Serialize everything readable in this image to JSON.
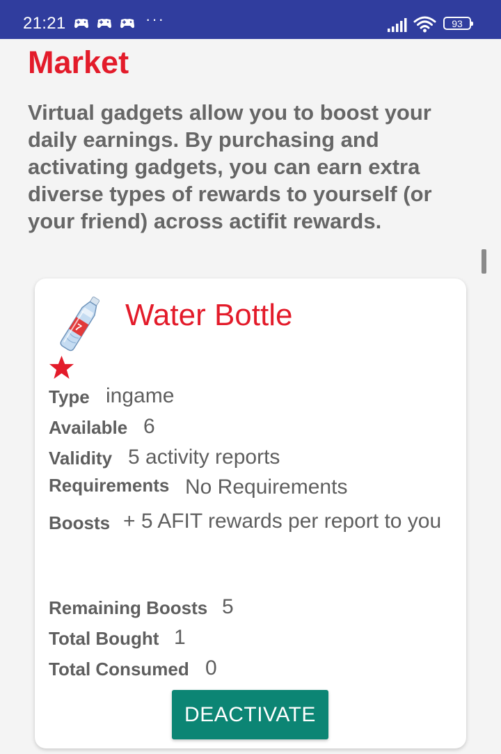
{
  "status_bar": {
    "time": "21:21",
    "notification_icons": [
      "game-controller-icon",
      "game-controller-icon",
      "game-controller-icon"
    ],
    "more": "···",
    "battery": "93",
    "background": "#303d9e"
  },
  "page": {
    "title": "Market",
    "intro": "Virtual gadgets allow you to boost your daily earnings. By purchasing and activating gadgets, you can earn extra diverse types of rewards to yourself (or your friend) across actifit rewards."
  },
  "gadget": {
    "name": "Water Bottle",
    "icon": "water-bottle-icon",
    "badge_icon": "star-icon",
    "fields": {
      "type": {
        "label": "Type",
        "value": "ingame"
      },
      "available": {
        "label": "Available",
        "value": "6"
      },
      "validity": {
        "label": "Validity",
        "value": "5 activity reports"
      },
      "requirements": {
        "label": "Requirements",
        "value": "No Requirements"
      },
      "boosts": {
        "label": "Boosts",
        "value": "+ 5 AFIT rewards per report to you"
      },
      "remaining_boosts": {
        "label": "Remaining Boosts",
        "value": "5"
      },
      "total_bought": {
        "label": "Total Bought",
        "value": "1"
      },
      "total_consumed": {
        "label": "Total Consumed",
        "value": "0"
      }
    },
    "action_label": "DEACTIVATE"
  },
  "colors": {
    "title_red": "#e31b2a",
    "button_teal": "#0c8574",
    "text_gray": "#5e5e5e",
    "background": "#f4f4f4"
  }
}
